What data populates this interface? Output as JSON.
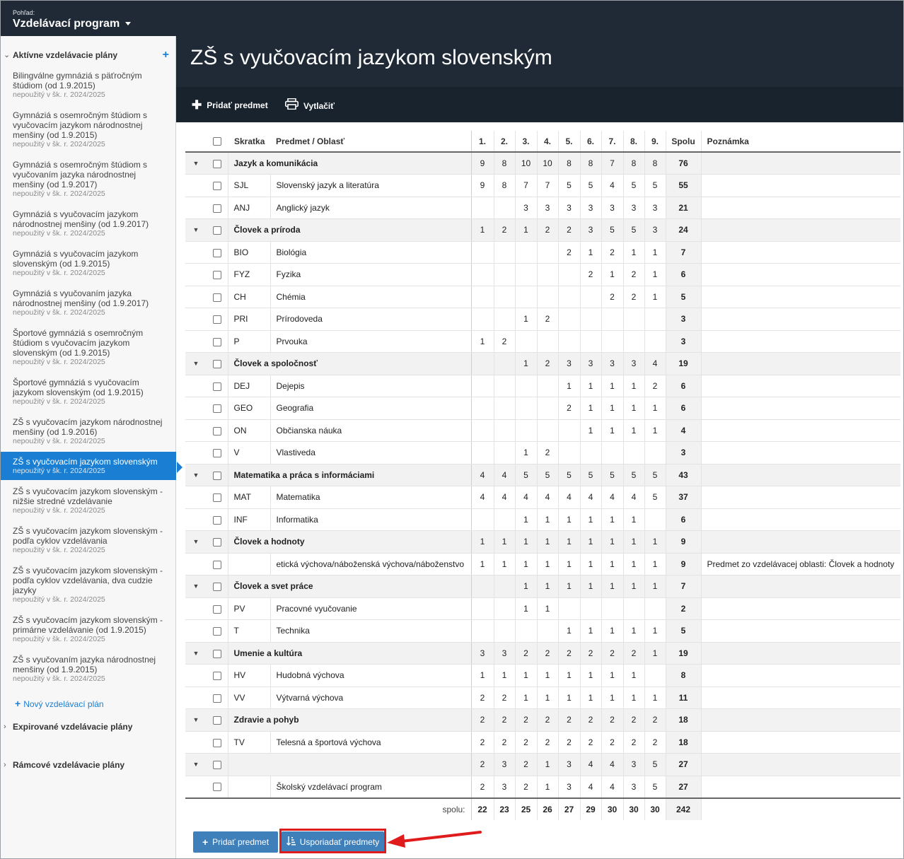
{
  "view": {
    "label": "Pohľad:",
    "value": "Vzdelávací program"
  },
  "sidebar": {
    "active_section": "Aktívne vzdelávacie plány",
    "plans": [
      {
        "name": [
          "Bilingválne gymnáziá s päťročným",
          "štúdiom (od 1.9.2015)"
        ],
        "sub": "nepoužitý v šk. r. 2024/2025"
      },
      {
        "name": [
          "Gymnáziá s osemročným štúdiom s",
          "vyučovacím jazykom národnostnej",
          "menšiny (od 1.9.2015)"
        ],
        "sub": "nepoužitý v šk. r. 2024/2025"
      },
      {
        "name": [
          "Gymnáziá s osemročným štúdiom s",
          "vyučovaním jazyka národnostnej",
          "menšiny (od 1.9.2017)"
        ],
        "sub": "nepoužitý v šk. r. 2024/2025"
      },
      {
        "name": [
          "Gymnáziá s vyučovacím jazykom",
          "národnostnej menšiny (od 1.9.2017)"
        ],
        "sub": "nepoužitý v šk. r. 2024/2025"
      },
      {
        "name": [
          "Gymnáziá s vyučovacím jazykom",
          "slovenským (od 1.9.2015)"
        ],
        "sub": "nepoužitý v šk. r. 2024/2025"
      },
      {
        "name": [
          "Gymnáziá s vyučovaním jazyka",
          "národnostnej menšiny (od 1.9.2017)"
        ],
        "sub": "nepoužitý v šk. r. 2024/2025"
      },
      {
        "name": [
          "Športové gymnáziá s osemročným",
          "štúdiom s vyučovacím jazykom",
          "slovenským (od 1.9.2015)"
        ],
        "sub": "nepoužitý v šk. r. 2024/2025"
      },
      {
        "name": [
          "Športové gymnáziá s vyučovacím",
          "jazykom slovenským (od 1.9.2015)"
        ],
        "sub": "nepoužitý v šk. r. 2024/2025"
      },
      {
        "name": [
          "ZŠ s vyučovacím jazykom národnostnej",
          "menšiny (od 1.9.2016)"
        ],
        "sub": "nepoužitý v šk. r. 2024/2025"
      },
      {
        "name": [
          "ZŠ s vyučovacím jazykom slovenským"
        ],
        "sub": "nepoužitý v šk. r. 2024/2025"
      },
      {
        "name": [
          "ZŠ s vyučovacím jazykom slovenským -",
          "nižšie stredné vzdelávanie"
        ],
        "sub": "nepoužitý v šk. r. 2024/2025"
      },
      {
        "name": [
          "ZŠ s vyučovacím jazykom slovenským -",
          "podľa cyklov vzdelávania"
        ],
        "sub": "nepoužitý v šk. r. 2024/2025"
      },
      {
        "name": [
          "ZŠ s vyučovacím jazykom slovenským -",
          "podľa cyklov vzdelávania, dva cudzie",
          "jazyky"
        ],
        "sub": "nepoužitý v šk. r. 2024/2025"
      },
      {
        "name": [
          "ZŠ s vyučovacím jazykom slovenským -",
          "primárne vzdelávanie (od 1.9.2015)"
        ],
        "sub": "nepoužitý v šk. r. 2024/2025"
      },
      {
        "name": [
          "ZŠ s vyučovaním jazyka národnostnej",
          "menšiny (od 1.9.2015)"
        ],
        "sub": "nepoužitý v šk. r. 2024/2025"
      }
    ],
    "new_plan": "Nový vzdelávací plán",
    "expired_section": "Expirované vzdelávacie plány",
    "framework_section": "Rámcové vzdelávacie plány"
  },
  "main": {
    "title": "ZŠ s vyučovacím jazykom slovenským",
    "toolbar": {
      "add_subject": "Pridať predmet",
      "print": "Vytlačiť"
    },
    "columns": {
      "abbr": "Skratka",
      "subject": "Predmet / Oblasť",
      "grades": [
        "1.",
        "2.",
        "3.",
        "4.",
        "5.",
        "6.",
        "7.",
        "8.",
        "9."
      ],
      "total": "Spolu",
      "note": "Poznámka"
    },
    "rows": [
      {
        "group": true,
        "name": "Jazyk a komunikácia",
        "v": [
          "9",
          "8",
          "10",
          "10",
          "8",
          "8",
          "7",
          "8",
          "8"
        ],
        "total": "76",
        "note": ""
      },
      {
        "abbr": "SJL",
        "name": "Slovenský jazyk a literatúra",
        "v": [
          "9",
          "8",
          "7",
          "7",
          "5",
          "5",
          "4",
          "5",
          "5"
        ],
        "total": "55",
        "note": ""
      },
      {
        "abbr": "ANJ",
        "name": "Anglický jazyk",
        "v": [
          "",
          "",
          "3",
          "3",
          "3",
          "3",
          "3",
          "3",
          "3"
        ],
        "total": "21",
        "note": ""
      },
      {
        "group": true,
        "name": "Človek a príroda",
        "v": [
          "1",
          "2",
          "1",
          "2",
          "2",
          "3",
          "5",
          "5",
          "3"
        ],
        "total": "24",
        "note": ""
      },
      {
        "abbr": "BIO",
        "name": "Biológia",
        "v": [
          "",
          "",
          "",
          "",
          "2",
          "1",
          "2",
          "1",
          "1"
        ],
        "total": "7",
        "note": ""
      },
      {
        "abbr": "FYZ",
        "name": "Fyzika",
        "v": [
          "",
          "",
          "",
          "",
          "",
          "2",
          "1",
          "2",
          "1"
        ],
        "total": "6",
        "note": ""
      },
      {
        "abbr": "CH",
        "name": "Chémia",
        "v": [
          "",
          "",
          "",
          "",
          "",
          "",
          "2",
          "2",
          "1"
        ],
        "total": "5",
        "note": ""
      },
      {
        "abbr": "PRI",
        "name": "Prírodoveda",
        "v": [
          "",
          "",
          "1",
          "2",
          "",
          "",
          "",
          "",
          ""
        ],
        "total": "3",
        "note": ""
      },
      {
        "abbr": "P",
        "name": "Prvouka",
        "v": [
          "1",
          "2",
          "",
          "",
          "",
          "",
          "",
          "",
          ""
        ],
        "total": "3",
        "note": ""
      },
      {
        "group": true,
        "name": "Človek a spoločnosť",
        "v": [
          "",
          "",
          "1",
          "2",
          "3",
          "3",
          "3",
          "3",
          "4"
        ],
        "total": "19",
        "note": ""
      },
      {
        "abbr": "DEJ",
        "name": "Dejepis",
        "v": [
          "",
          "",
          "",
          "",
          "1",
          "1",
          "1",
          "1",
          "2"
        ],
        "total": "6",
        "note": ""
      },
      {
        "abbr": "GEO",
        "name": "Geografia",
        "v": [
          "",
          "",
          "",
          "",
          "2",
          "1",
          "1",
          "1",
          "1"
        ],
        "total": "6",
        "note": ""
      },
      {
        "abbr": "ON",
        "name": "Občianska náuka",
        "v": [
          "",
          "",
          "",
          "",
          "",
          "1",
          "1",
          "1",
          "1"
        ],
        "total": "4",
        "note": ""
      },
      {
        "abbr": "V",
        "name": "Vlastiveda",
        "v": [
          "",
          "",
          "1",
          "2",
          "",
          "",
          "",
          "",
          ""
        ],
        "total": "3",
        "note": ""
      },
      {
        "group": true,
        "name": "Matematika a práca s informáciami",
        "v": [
          "4",
          "4",
          "5",
          "5",
          "5",
          "5",
          "5",
          "5",
          "5"
        ],
        "total": "43",
        "note": ""
      },
      {
        "abbr": "MAT",
        "name": "Matematika",
        "v": [
          "4",
          "4",
          "4",
          "4",
          "4",
          "4",
          "4",
          "4",
          "5"
        ],
        "total": "37",
        "note": ""
      },
      {
        "abbr": "INF",
        "name": "Informatika",
        "v": [
          "",
          "",
          "1",
          "1",
          "1",
          "1",
          "1",
          "1",
          ""
        ],
        "total": "6",
        "note": ""
      },
      {
        "group": true,
        "name": "Človek a hodnoty",
        "v": [
          "1",
          "1",
          "1",
          "1",
          "1",
          "1",
          "1",
          "1",
          "1"
        ],
        "total": "9",
        "note": ""
      },
      {
        "abbr": "",
        "name": "etická výchova/náboženská výchova/náboženstvo",
        "v": [
          "1",
          "1",
          "1",
          "1",
          "1",
          "1",
          "1",
          "1",
          "1"
        ],
        "total": "9",
        "note": "Predmet zo vzdelávacej oblasti: Človek a hodnoty"
      },
      {
        "group": true,
        "name": "Človek a svet práce",
        "v": [
          "",
          "",
          "1",
          "1",
          "1",
          "1",
          "1",
          "1",
          "1"
        ],
        "total": "7",
        "note": ""
      },
      {
        "abbr": "PV",
        "name": "Pracovné vyučovanie",
        "v": [
          "",
          "",
          "1",
          "1",
          "",
          "",
          "",
          "",
          ""
        ],
        "total": "2",
        "note": ""
      },
      {
        "abbr": "T",
        "name": "Technika",
        "v": [
          "",
          "",
          "",
          "",
          "1",
          "1",
          "1",
          "1",
          "1"
        ],
        "total": "5",
        "note": ""
      },
      {
        "group": true,
        "name": "Umenie a kultúra",
        "v": [
          "3",
          "3",
          "2",
          "2",
          "2",
          "2",
          "2",
          "2",
          "1"
        ],
        "total": "19",
        "note": ""
      },
      {
        "abbr": "HV",
        "name": "Hudobná výchova",
        "v": [
          "1",
          "1",
          "1",
          "1",
          "1",
          "1",
          "1",
          "1",
          ""
        ],
        "total": "8",
        "note": ""
      },
      {
        "abbr": "VV",
        "name": "Výtvarná výchova",
        "v": [
          "2",
          "2",
          "1",
          "1",
          "1",
          "1",
          "1",
          "1",
          "1"
        ],
        "total": "11",
        "note": ""
      },
      {
        "group": true,
        "name": "Zdravie a pohyb",
        "v": [
          "2",
          "2",
          "2",
          "2",
          "2",
          "2",
          "2",
          "2",
          "2"
        ],
        "total": "18",
        "note": ""
      },
      {
        "abbr": "TV",
        "name": "Telesná a športová výchova",
        "v": [
          "2",
          "2",
          "2",
          "2",
          "2",
          "2",
          "2",
          "2",
          "2"
        ],
        "total": "18",
        "note": ""
      },
      {
        "group": true,
        "name": "",
        "v": [
          "2",
          "3",
          "2",
          "1",
          "3",
          "4",
          "4",
          "3",
          "5"
        ],
        "total": "27",
        "note": ""
      },
      {
        "abbr": "",
        "name": "Školský vzdelávací program",
        "v": [
          "2",
          "3",
          "2",
          "1",
          "3",
          "4",
          "4",
          "3",
          "5"
        ],
        "total": "27",
        "note": ""
      }
    ],
    "totals": {
      "label": "spolu:",
      "v": [
        "22",
        "23",
        "25",
        "26",
        "27",
        "29",
        "30",
        "30",
        "30"
      ],
      "total": "242"
    },
    "bottom": {
      "add_subject": "Pridať predmet",
      "sort_subjects": "Usporiadať predmety"
    }
  }
}
